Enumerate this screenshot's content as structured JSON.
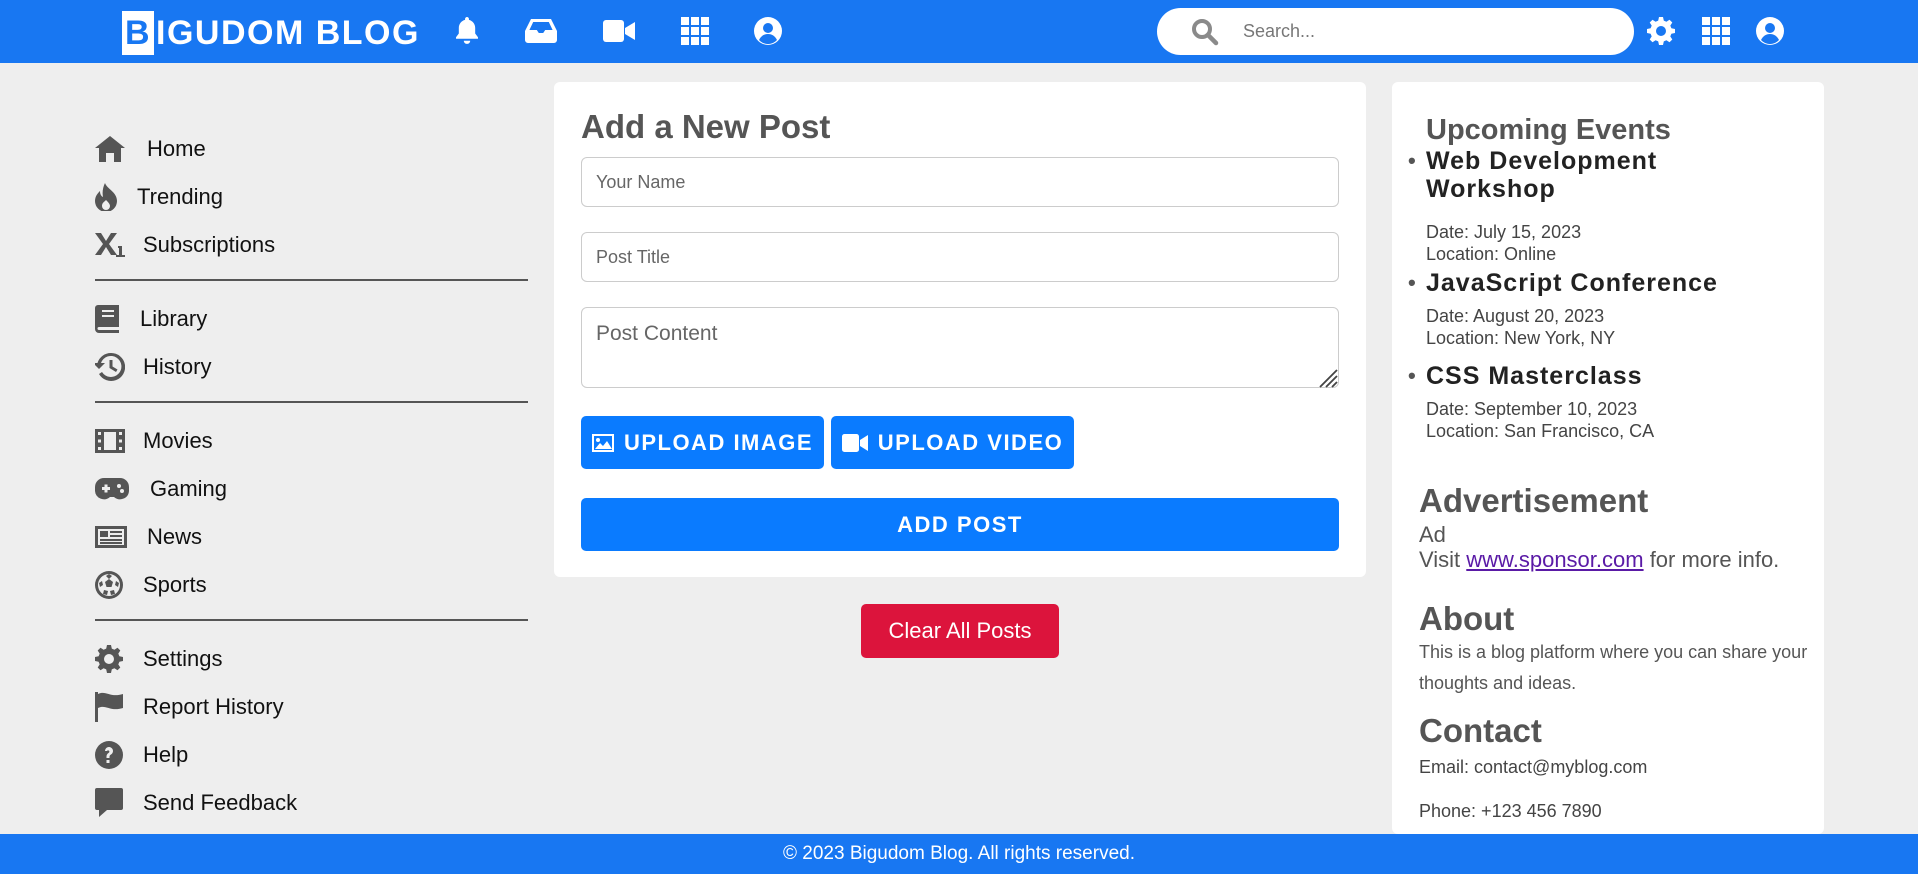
{
  "header": {
    "logo_letter": "B",
    "logo_rest": "IGUDOM BLOG",
    "icons": [
      "bell-icon",
      "inbox-icon",
      "video-camera-icon",
      "grid-icon",
      "user-circle-icon"
    ],
    "search_placeholder": "Search...",
    "right_icons": [
      "gear-icon",
      "grid-icon",
      "user-circle-icon"
    ]
  },
  "sidebar": {
    "groups": [
      [
        {
          "label": "Home",
          "icon": "home-icon"
        },
        {
          "label": "Trending",
          "icon": "fire-icon"
        },
        {
          "label": "Subscriptions",
          "icon": "subscript-icon"
        }
      ],
      [
        {
          "label": "Library",
          "icon": "book-icon"
        },
        {
          "label": "History",
          "icon": "history-icon"
        }
      ],
      [
        {
          "label": "Movies",
          "icon": "film-icon"
        },
        {
          "label": "Gaming",
          "icon": "gamepad-icon"
        },
        {
          "label": "News",
          "icon": "newspaper-icon"
        },
        {
          "label": "Sports",
          "icon": "soccer-ball-icon"
        }
      ],
      [
        {
          "label": "Settings",
          "icon": "gear-icon"
        },
        {
          "label": "Report History",
          "icon": "flag-icon"
        },
        {
          "label": "Help",
          "icon": "question-circle-icon"
        },
        {
          "label": "Send Feedback",
          "icon": "comment-icon"
        }
      ]
    ]
  },
  "post_form": {
    "title": "Add a New Post",
    "name_placeholder": "Your Name",
    "post_title_placeholder": "Post Title",
    "content_placeholder": "Post Content",
    "upload_image_label": "UPLOAD IMAGE",
    "upload_video_label": "UPLOAD VIDEO",
    "add_post_label": "ADD POST"
  },
  "clear_posts_label": "Clear All Posts",
  "events": {
    "title": "Upcoming Events",
    "items": [
      {
        "name": "Web Development Workshop",
        "date": "Date: July 15, 2023",
        "location": "Location: Online"
      },
      {
        "name": "JavaScript Conference",
        "date": "Date: August 20, 2023",
        "location": "Location: New York, NY"
      },
      {
        "name": "CSS Masterclass",
        "date": "Date: September 10, 2023",
        "location": "Location: San Francisco, CA"
      }
    ]
  },
  "advertisement": {
    "title": "Advertisement",
    "ad_text": "Ad",
    "visit_prefix": "Visit ",
    "link_text": "www.sponsor.com",
    "visit_suffix": " for more info."
  },
  "about": {
    "title": "About",
    "text": "This is a blog platform where you can share your thoughts and ideas."
  },
  "contact": {
    "title": "Contact",
    "email": "Email: contact@myblog.com",
    "phone": "Phone: +123 456 7890"
  },
  "footer": {
    "text": "© 2023 Bigudom Blog. All rights reserved."
  },
  "colors": {
    "brand_blue": "#1877f2",
    "button_blue": "#0a7bff",
    "danger_red": "#dc143c"
  }
}
